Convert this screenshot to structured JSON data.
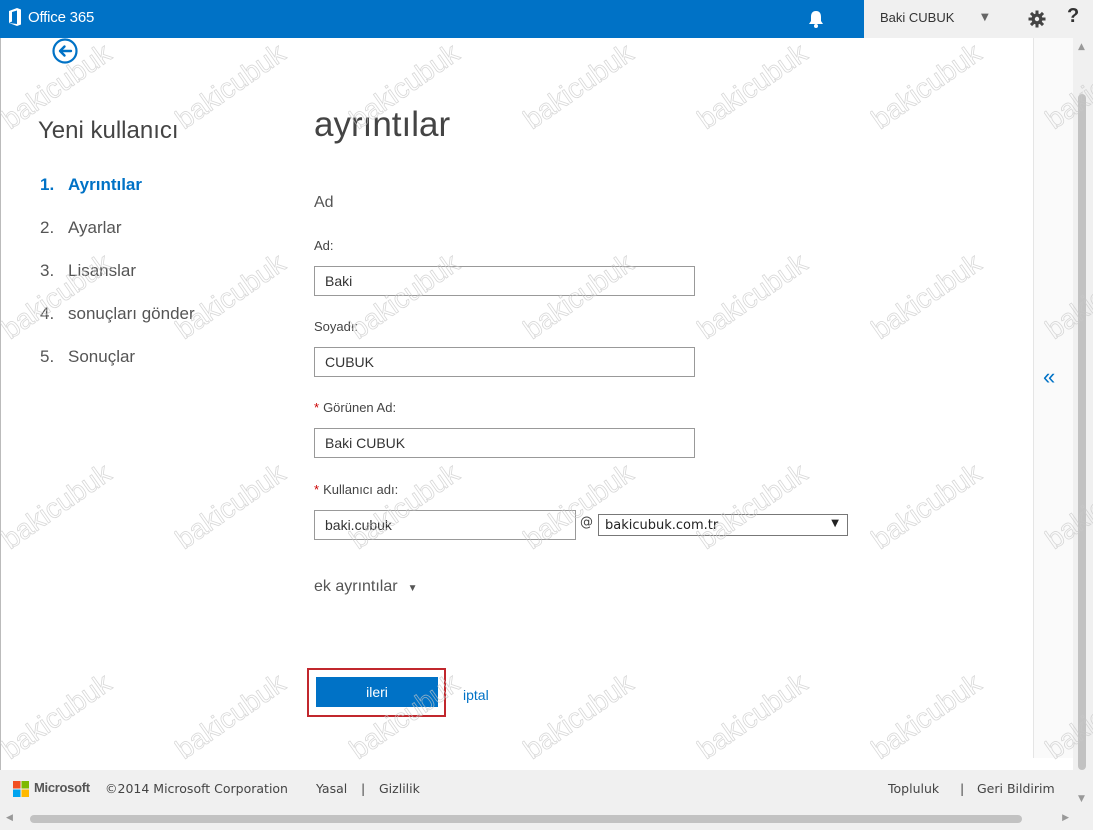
{
  "header": {
    "brand": "Office 365",
    "user_name": "Baki CUBUK",
    "help_label": "?"
  },
  "wizard": {
    "title": "Yeni kullanıcı",
    "steps": [
      {
        "num": "1.",
        "label": "Ayrıntılar"
      },
      {
        "num": "2.",
        "label": "Ayarlar"
      },
      {
        "num": "3.",
        "label": "Lisanslar"
      },
      {
        "num": "4.",
        "label": "sonuçları gönder"
      },
      {
        "num": "5.",
        "label": "Sonuçlar"
      }
    ]
  },
  "form": {
    "section_title": "ayrıntılar",
    "group_heading": "Ad",
    "first_name_label": "Ad:",
    "first_name_value": "Baki",
    "last_name_label": "Soyadı:",
    "last_name_value": "CUBUK",
    "display_name_label": "Görünen Ad:",
    "display_name_value": "Baki CUBUK",
    "username_label": "Kullanıcı adı:",
    "username_value": "baki.cubuk",
    "at_sign": "@",
    "domain_value": "bakicubuk.com.tr",
    "required_marker": "*",
    "more_details": "ek ayrıntılar"
  },
  "actions": {
    "next_label": "ileri",
    "cancel_label": "iptal"
  },
  "side_panel": {
    "collapse_glyph": "«"
  },
  "footer": {
    "brand": "Microsoft",
    "copyright": "©2014 Microsoft Corporation",
    "legal": "Yasal",
    "privacy": "Gizlilik",
    "separator": "|",
    "community": "Topluluk",
    "feedback": "Geri Bildirim"
  },
  "watermark": "bakicubuk",
  "colors": {
    "accent": "#0072c6",
    "highlight": "#c1272d",
    "required": "#cc0000"
  }
}
